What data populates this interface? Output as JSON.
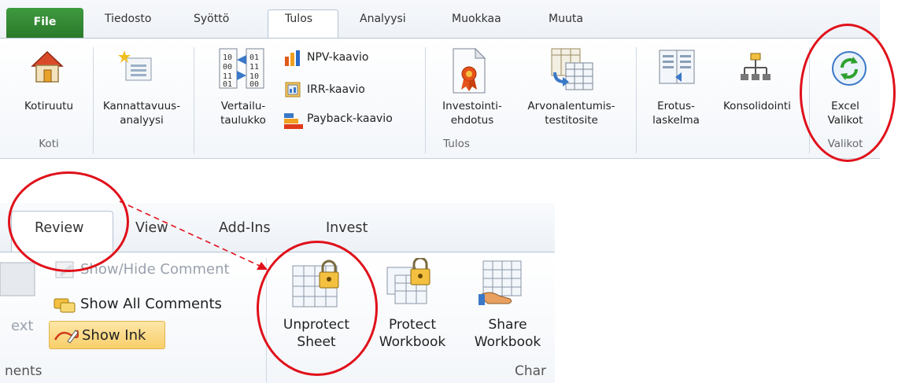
{
  "top_ribbon": {
    "tabs": {
      "file": "File",
      "tiedosto": "Tiedosto",
      "syotto": "Syöttö",
      "tulos": "Tulos",
      "analyysi": "Analyysi",
      "muokkaa": "Muokkaa",
      "muuta": "Muuta"
    },
    "buttons": {
      "kotiruutu": "Kotiruutu",
      "kannattavuus_l1": "Kannattavuus-",
      "kannattavuus_l2": "analyysi",
      "vertailu_l1": "Vertailu-",
      "vertailu_l2": "taulukko",
      "npv": "NPV-kaavio",
      "irr": "IRR-kaavio",
      "payback": "Payback-kaavio",
      "investointi_l1": "Investointi-",
      "investointi_l2": "ehdotus",
      "arvonalentumis_l1": "Arvonalentumis-",
      "arvonalentumis_l2": "testitosite",
      "erotus_l1": "Erotus-",
      "erotus_l2": "laskelma",
      "konsolidointi": "Konsolidointi",
      "excel_l1": "Excel",
      "excel_l2": "Valikot"
    },
    "groups": {
      "koti": "Koti",
      "tulos": "Tulos",
      "valikot": "Valikot"
    }
  },
  "bottom_ribbon": {
    "tabs": {
      "review": "Review",
      "view": "View",
      "addins": "Add-Ins",
      "invest": "Invest"
    },
    "items": {
      "show_hide_comment": "Show/Hide Comment",
      "show_all_comments": "Show All Comments",
      "show_ink": "Show Ink",
      "next_fragment": "ext",
      "unprotect_l1": "Unprotect",
      "unprotect_l2": "Sheet",
      "protect_l1": "Protect",
      "protect_l2": "Workbook",
      "share_l1": "Share",
      "share_l2": "Workbook"
    },
    "groups": {
      "comments_fragment": "nents",
      "changes_fragment": "Char"
    }
  },
  "colors": {
    "annotation_red": "#e0101a",
    "file_tab_green": "#2a7a2a"
  }
}
